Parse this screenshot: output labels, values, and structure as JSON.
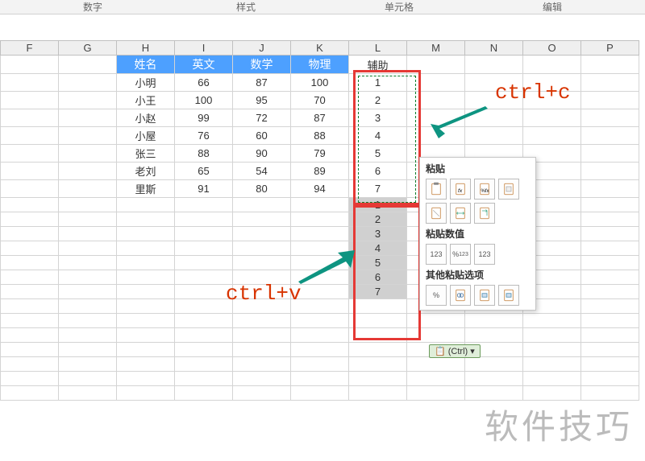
{
  "ribbon": {
    "g1": "数字",
    "g2": "样式",
    "g3": "单元格",
    "g4": "编辑"
  },
  "columns": [
    "F",
    "G",
    "H",
    "I",
    "J",
    "K",
    "L",
    "M",
    "N",
    "O",
    "P"
  ],
  "headers": {
    "h": "姓名",
    "i": "英文",
    "j": "数学",
    "k": "物理",
    "l": "辅助"
  },
  "rows": [
    {
      "name": "小明",
      "en": "66",
      "math": "87",
      "phy": "100",
      "aux": "1"
    },
    {
      "name": "小王",
      "en": "100",
      "math": "95",
      "phy": "70",
      "aux": "2"
    },
    {
      "name": "小赵",
      "en": "99",
      "math": "72",
      "phy": "87",
      "aux": "3"
    },
    {
      "name": "小屋",
      "en": "76",
      "math": "60",
      "phy": "88",
      "aux": "4"
    },
    {
      "name": "张三",
      "en": "88",
      "math": "90",
      "phy": "79",
      "aux": "5"
    },
    {
      "name": "老刘",
      "en": "65",
      "math": "54",
      "phy": "89",
      "aux": "6"
    },
    {
      "name": "里斯",
      "en": "91",
      "math": "80",
      "phy": "94",
      "aux": "7"
    }
  ],
  "pasted": [
    "1",
    "2",
    "3",
    "4",
    "5",
    "6",
    "7"
  ],
  "labels": {
    "copy": "ctrl+c",
    "paste": "ctrl+v"
  },
  "popup": {
    "sect1": "粘贴",
    "sect2": "粘贴数值",
    "sect3": "其他粘贴选项",
    "v123": "123",
    "vpct": "%",
    "ctrl_text": "(Ctrl)"
  },
  "watermark": "软件技巧",
  "colors": {
    "accent": "#4da0ff",
    "redbox": "#e53935",
    "arrow": "#0e9481",
    "anno": "#d83400"
  }
}
